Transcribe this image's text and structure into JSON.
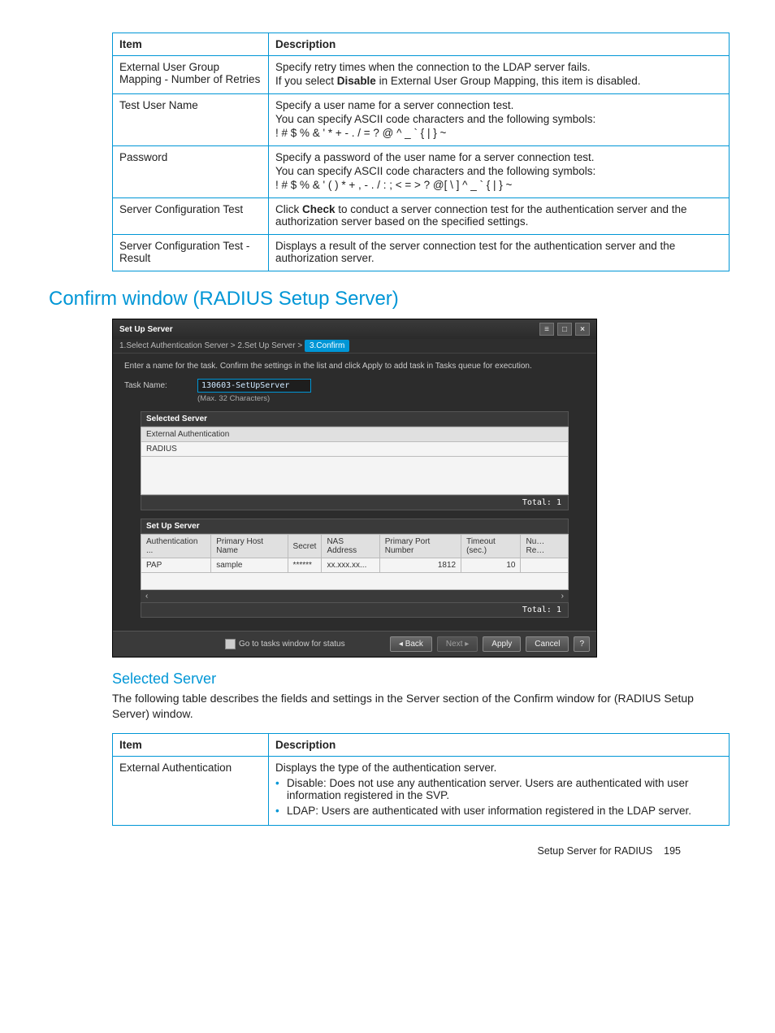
{
  "table1": {
    "head_item": "Item",
    "head_desc": "Description",
    "rows": [
      {
        "item": "External User Group Mapping - Number of Retries",
        "desc_lines": [
          "Specify retry times when the connection to the LDAP server fails.",
          [
            "If you select ",
            "Disable",
            " in External User Group Mapping, this item is disabled."
          ]
        ]
      },
      {
        "item": "Test User Name",
        "desc_lines": [
          "Specify a user name for a server connection test.",
          "You can specify ASCII code characters and the following symbols:",
          "! # $ % & ' * + - . / = ? @ ^ _ ` { | } ~"
        ]
      },
      {
        "item": "Password",
        "desc_lines": [
          "Specify a password of the user name for a server connection test.",
          "You can specify ASCII code characters and the following symbols:",
          "! # $ % & ' ( ) * + , - . / : ; < = > ? @[ \\ ] ^ _ ` { | } ~"
        ]
      },
      {
        "item": "Server Configuration Test",
        "desc_lines": [
          [
            "Click ",
            "Check",
            " to conduct a server connection test for the authentication server and the authorization server based on the specified settings."
          ]
        ]
      },
      {
        "item": "Server Configuration Test - Result",
        "desc_lines": [
          "Displays a result of the server connection test for the authentication server and the authorization server."
        ]
      }
    ]
  },
  "heading_confirm": "Confirm window (RADIUS Setup Server)",
  "window": {
    "title": "Set Up Server",
    "crumb1": "1.Select Authentication Server",
    "arrow": ">",
    "crumb2": "2.Set Up Server",
    "crumb3": "3.Confirm",
    "instruction": "Enter a name for the task. Confirm the settings in the list and click Apply to add task in Tasks queue for execution.",
    "task_label": "Task Name:",
    "task_value": "130603-SetUpServer",
    "task_hint": "(Max. 32 Characters)",
    "selserver_hdr": "Selected Server",
    "selserver_col": "External Authentication",
    "selserver_val": "RADIUS",
    "total1": "Total: 1",
    "setup_hdr": "Set Up Server",
    "setup_cols": [
      "Authentication ...",
      "Primary Host Name",
      "Secret",
      "NAS Address",
      "Primary Port Number",
      "Timeout (sec.)",
      "Nu… Re…"
    ],
    "setup_row": [
      "PAP",
      "sample",
      "******",
      "xx.xxx.xx...",
      "1812",
      "10",
      ""
    ],
    "scroll_left": "‹",
    "scroll_right": "›",
    "total2": "Total: 1",
    "go_status": "Go to tasks window for status",
    "btn_back": "◂ Back",
    "btn_next": "Next ▸",
    "btn_apply": "Apply",
    "btn_cancel": "Cancel",
    "btn_help": "?"
  },
  "sub_heading": "Selected Server",
  "sub_para": "The following table describes the fields and settings in the Server section of the Confirm window for (RADIUS Setup Server) window.",
  "table2": {
    "head_item": "Item",
    "head_desc": "Description",
    "row_item": "External Authentication",
    "row_desc_line1": "Displays the type of the authentication server.",
    "bullets": [
      "Disable: Does not use any authentication server. Users are authenticated with user information registered in the SVP.",
      "LDAP: Users are authenticated with user information registered in the LDAP server."
    ]
  },
  "footer_label": "Setup Server for RADIUS",
  "footer_page": "195"
}
